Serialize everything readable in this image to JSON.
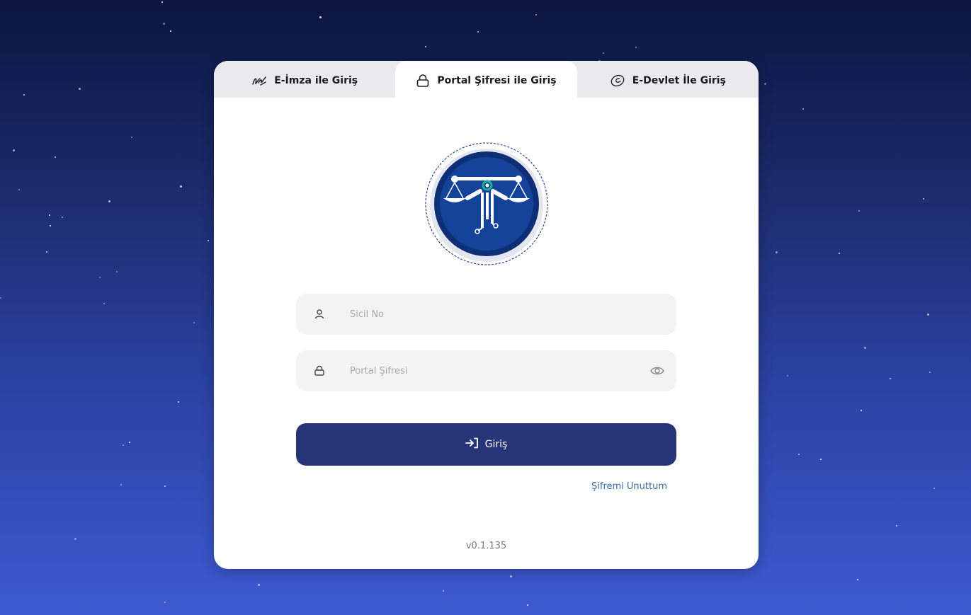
{
  "tabs": [
    {
      "label": "E-İmza ile Giriş",
      "icon": "signature-icon",
      "active": false
    },
    {
      "label": "Portal Şifresi ile Giriş",
      "icon": "lock-icon",
      "active": true
    },
    {
      "label": "E-Devlet İle Giriş",
      "icon": "edevlet-icon",
      "active": false
    }
  ],
  "form": {
    "username_placeholder": "Sicil No",
    "username_value": "",
    "password_placeholder": "Portal Şifresi",
    "password_value": "",
    "submit_label": "Giriş",
    "forgot_label": "Şifremi Unuttum"
  },
  "footer": {
    "version": "v0.1.135"
  },
  "colors": {
    "primary": "#273578",
    "link": "#3b6a9e",
    "logo_blue": "#143d8c",
    "logo_accent": "#18b38a"
  }
}
